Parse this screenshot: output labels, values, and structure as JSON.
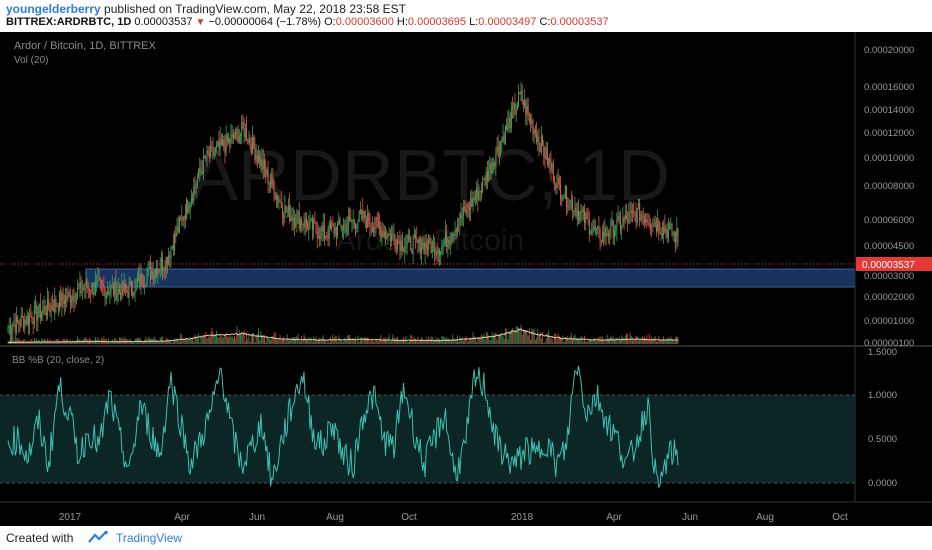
{
  "header": {
    "author": "youngelderberry",
    "published_text": "published on TradingView.com, May 22, 2018 23:58 EST",
    "symbol": "BITTREX:ARDRBTC, 1D",
    "last": "0.00003537",
    "change": "−0.00000064 (−1.78%)",
    "o_label": "O:",
    "o_value": "0.00003600",
    "h_label": "H:",
    "h_value": "0.00003695",
    "l_label": "L:",
    "l_value": "0.00003497",
    "c_label": "C:",
    "c_value": "0.00003537"
  },
  "chart": {
    "legend_title": "Ardor / Bitcoin, 1D, BITTREX",
    "legend_vol": "Vol (20)",
    "watermark": "ARDRBTC, 1D",
    "watermark_sub": "Ardor / Bitcoin",
    "price_label": "0.00003537",
    "indicator_label": "BB %B (20, close, 2)",
    "colors": {
      "background": "#000000",
      "up": "#33a35b",
      "down": "#d65a4a",
      "support_zone": "#1d3c6e",
      "bb_line": "#3dbfb2",
      "bb_band": "#0c2a28",
      "price_tag": "#e53935",
      "vol_ma": "#f2c79b"
    }
  },
  "chart_data": [
    {
      "type": "candlestick",
      "title": "Ardor / Bitcoin, 1D, BITTREX",
      "y_axis_ticks": [
        "0.00020000",
        "0.00016000",
        "0.00014000",
        "0.00012000",
        "0.00010000",
        "0.00008000",
        "0.00006000",
        "0.00004500",
        "0.00003000",
        "0.00002000",
        "0.00001000",
        "0.00000100"
      ],
      "x_axis_ticks": [
        "2017",
        "Apr",
        "Jun",
        "Aug",
        "Oct",
        "2018",
        "Apr",
        "Jun",
        "Aug",
        "Oct"
      ],
      "scale": "log",
      "ylim": [
        1e-06,
        0.00023
      ],
      "support_zone": [
        2.45e-05,
        3.35e-05
      ],
      "last_close": 3.537e-05,
      "series": [
        {
          "name": "",
          "dates": [
            "2016-12",
            "2017-01",
            "2017-02",
            "2017-03",
            "2017-04",
            "2017-05",
            "2017-06",
            "2017-07",
            "2017-08",
            "2017-09",
            "2017-10",
            "2017-11",
            "2017-12",
            "2018-01",
            "2018-02",
            "2018-03",
            "2018-04",
            "2018-05"
          ],
          "close": [
            1.5e-05,
            1.8e-05,
            2.2e-05,
            2.1e-05,
            2.8e-05,
            7.2e-05,
            9.5e-05,
            4.5e-05,
            3.6e-05,
            4.2e-05,
            3.3e-05,
            3.2e-05,
            5.5e-05,
            0.00013,
            5.5e-05,
            3.5e-05,
            4.4e-05,
            3.5e-05
          ]
        }
      ]
    },
    {
      "type": "line",
      "title": "BB %B (20, close, 2)",
      "y_axis_ticks": [
        "1.5000",
        "1.0000",
        "0.5000",
        "0.0000"
      ],
      "ylim": [
        -0.3,
        1.55
      ],
      "band": [
        0,
        1
      ],
      "series": [
        {
          "name": "",
          "values": [
            0.45,
            0.5,
            0.3,
            0.7,
            0.2,
            1.1,
            0.8,
            0.3,
            0.6,
            0.4,
            1.0,
            0.5,
            0.1,
            0.9,
            0.6,
            0.3,
            1.2,
            0.7,
            0.2,
            0.5,
            0.8,
            1.3,
            0.6,
            0.2,
            0.4,
            0.7,
            0.0,
            0.5,
            0.9,
            1.25,
            0.6,
            0.4,
            0.7,
            0.3,
            0.2,
            0.8,
            1.0,
            0.5,
            0.4,
            1.1,
            0.6,
            0.2,
            0.5,
            0.8,
            0.1,
            0.4,
            1.2,
            1.1,
            0.5,
            0.3,
            0.2,
            0.4,
            0.3,
            0.5,
            0.2,
            0.4,
            1.4,
            0.8,
            1.0,
            0.7,
            0.5,
            0.2,
            0.5,
            0.9,
            -0.1,
            0.3,
            0.35
          ]
        }
      ]
    }
  ],
  "footer": {
    "created_with": "Created with",
    "brand": "TradingView"
  }
}
